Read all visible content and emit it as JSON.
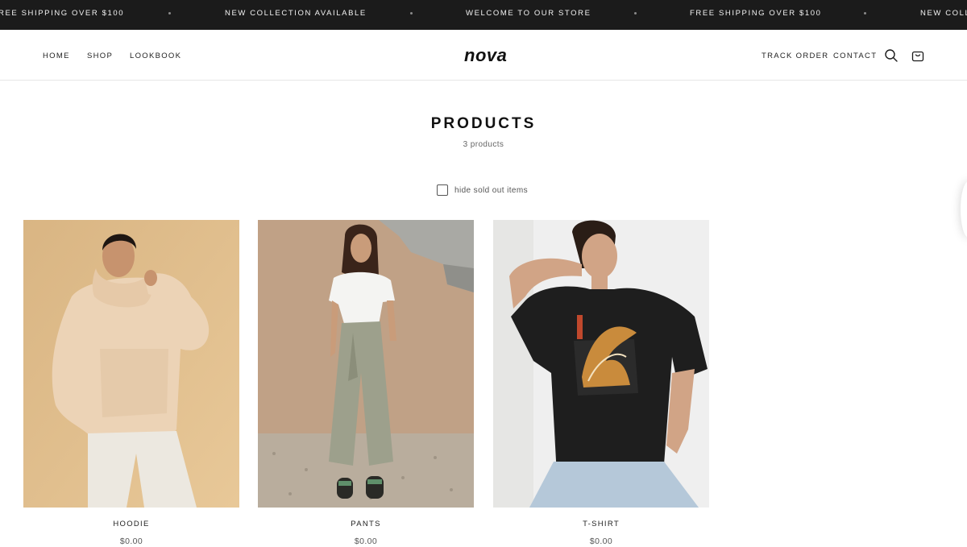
{
  "announcement": {
    "messages": [
      "REE SHIPPING OVER $100",
      "NEW COLLECTION AVAILABLE",
      "WELCOME TO OUR STORE",
      "FREE SHIPPING OVER $100",
      "NEW COLL"
    ]
  },
  "header": {
    "logo": "nova",
    "nav_left": [
      {
        "label": "HOME"
      },
      {
        "label": "SHOP"
      },
      {
        "label": "LOOKBOOK"
      }
    ],
    "nav_right": [
      {
        "label": "TRACK ORDER"
      },
      {
        "label": "CONTACT"
      }
    ],
    "icons": [
      "search-icon",
      "cart-icon"
    ]
  },
  "collection": {
    "title": "PRODUCTS",
    "count": "3 products",
    "filter_label": "hide sold out items",
    "filter_checked": false
  },
  "products": [
    {
      "name": "HOODIE",
      "price": "$0.00"
    },
    {
      "name": "PANTS",
      "price": "$0.00"
    },
    {
      "name": "T-SHIRT",
      "price": "$0.00"
    }
  ],
  "colors": {
    "announcement_bg": "#1b1b1b",
    "text": "#1a1a1a",
    "muted": "#666666"
  }
}
